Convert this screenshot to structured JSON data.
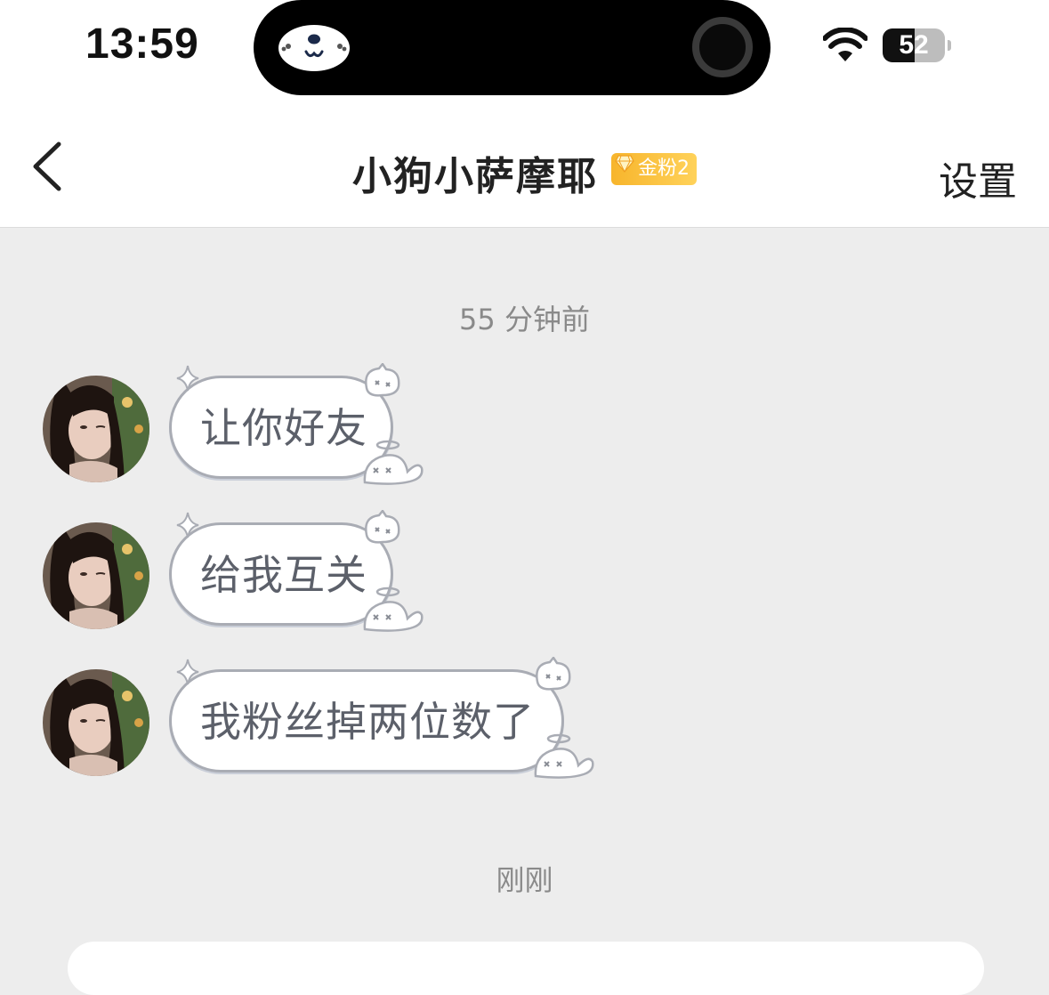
{
  "status_bar": {
    "time": "13:59",
    "battery_level": "52",
    "battery_fraction": 0.52
  },
  "nav": {
    "title": "小狗小萨摩耶",
    "fan_badge": "金粉2",
    "settings_label": "设置",
    "back_icon": "chevron-left-icon"
  },
  "chat": {
    "timestamp_1": "55 分钟前",
    "messages": [
      {
        "text": "让你好友"
      },
      {
        "text": "给我互关"
      },
      {
        "text": "我粉丝掉两位数了"
      }
    ],
    "timestamp_2": "刚刚"
  },
  "colors": {
    "background": "#ededed",
    "bubble_border": "#a9acb4",
    "badge_gold": "#f7b52c"
  }
}
